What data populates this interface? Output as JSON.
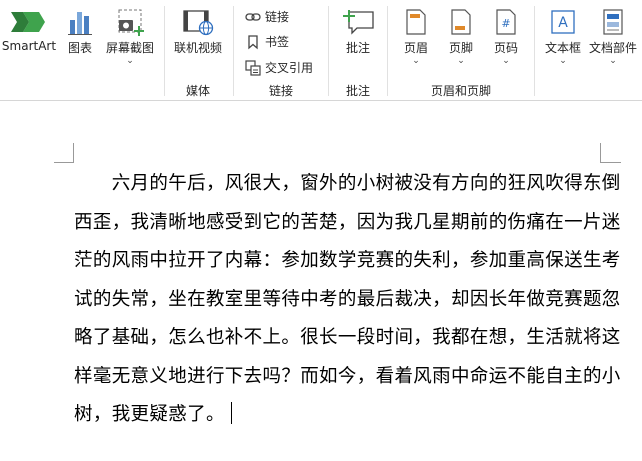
{
  "ribbon": {
    "buttons": {
      "smartart": "SmartArt",
      "chart": "图表",
      "screenshot": "屏幕截图",
      "online_video": "联机视频",
      "link": "链接",
      "bookmark": "书签",
      "cross_ref": "交叉引用",
      "comment": "批注",
      "header": "页眉",
      "footer": "页脚",
      "page_number": "页码",
      "textbox": "文本框",
      "doc_parts": "文档部件"
    },
    "groups": {
      "media": "媒体",
      "links": "链接",
      "comments": "批注",
      "header_footer": "页眉和页脚"
    },
    "caret": "⌄"
  },
  "document": {
    "lines": [
      "　　六月的午后，风很大，窗外的小树被没有方向的狂风吹得东倒",
      "西歪，我清晰地感受到它的苦楚，因为我几星期前的伤痛在一片迷",
      "茫的风雨中拉开了内幕：参加数学竞赛的失利，参加重高保送生考",
      "试的失常，坐在教室里等待中考的最后裁决，却因长年做竞赛题忽",
      "略了基础，怎么也补不上。很长一段时间，我都在想，生活就将这",
      "样毫无意义地进行下去吗？而如今，看着风雨中命运不能自主的小",
      "树，我更疑惑了。"
    ]
  }
}
